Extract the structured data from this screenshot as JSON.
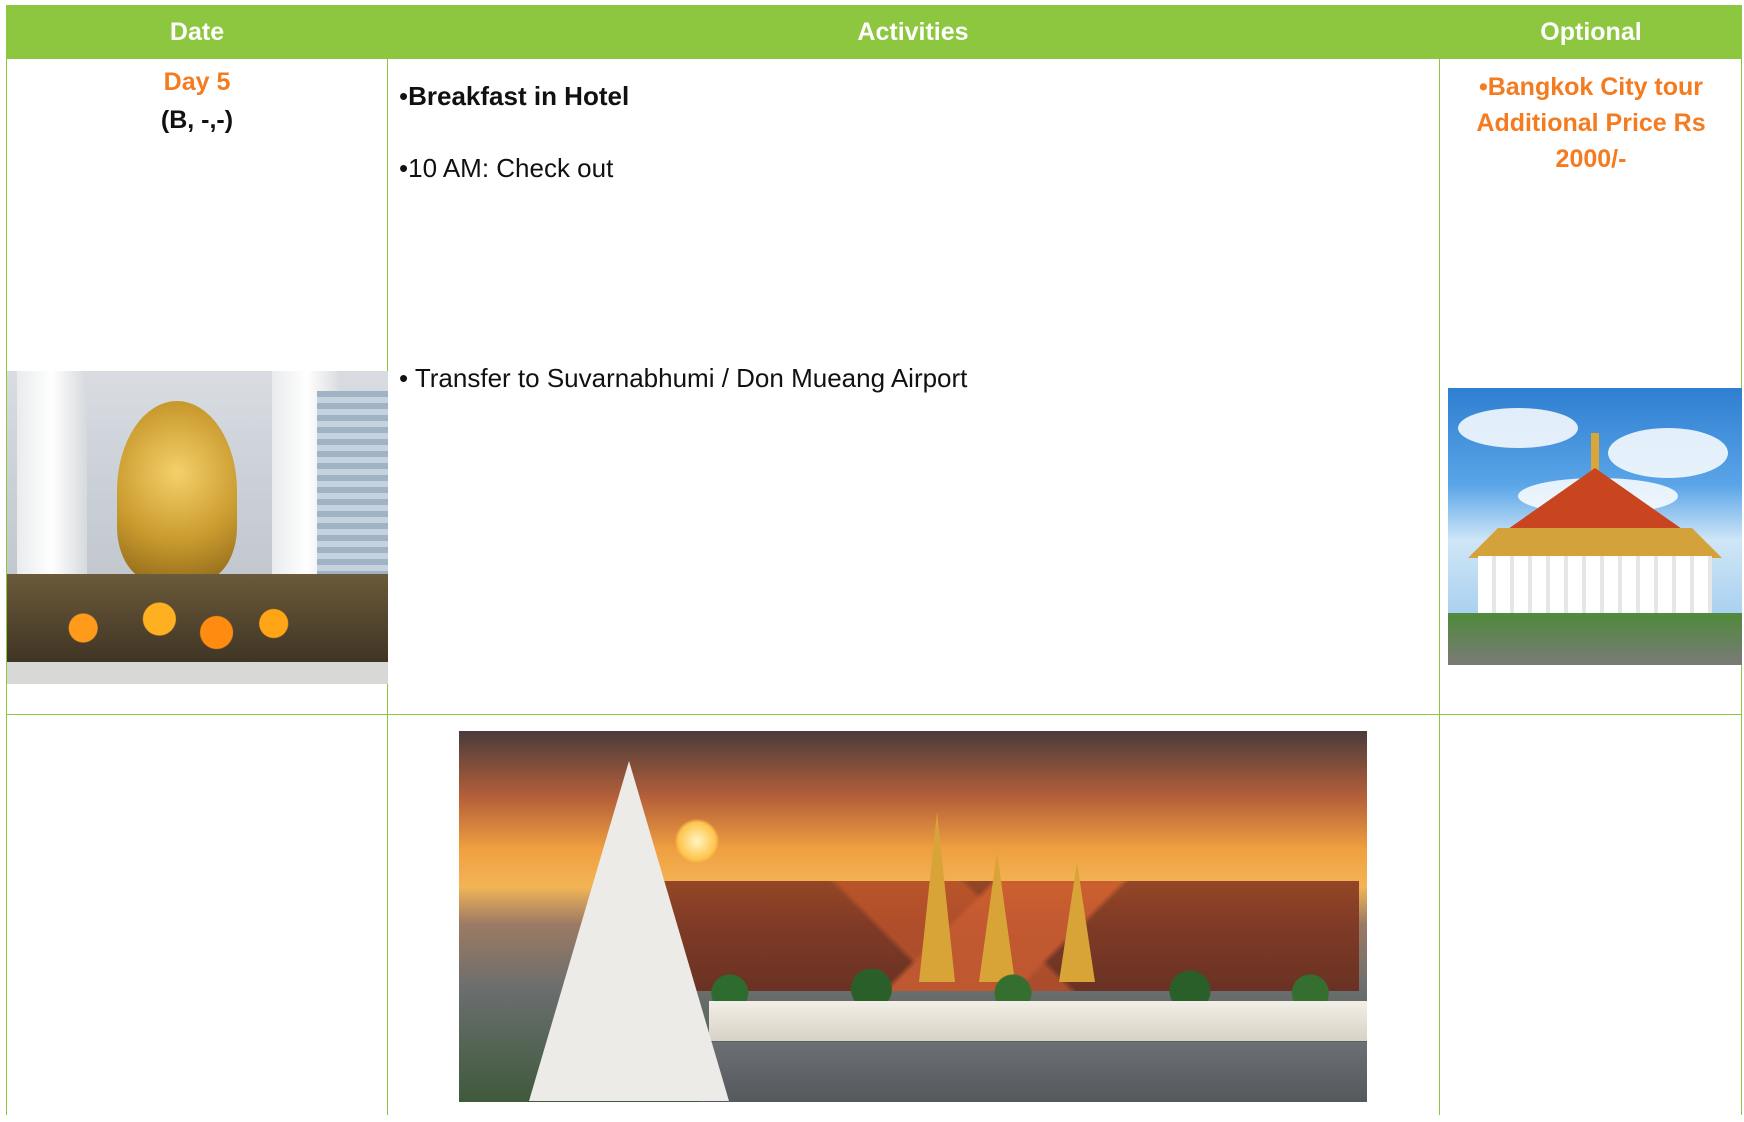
{
  "header": {
    "date": "Date",
    "activities": "Activities",
    "optional": "Optional"
  },
  "day": {
    "title": "Day 5",
    "meals": "(B, -,-)"
  },
  "activities": [
    {
      "bullet": "•",
      "text": "Breakfast in Hotel",
      "bold": true
    },
    {
      "bullet": "•",
      "text": "10 AM: Check out",
      "bold": false
    },
    {
      "bullet": "• ",
      "text": "Transfer to Suvarnabhumi / Don Mueang  Airport",
      "bold": false
    }
  ],
  "optional": {
    "line1": "•Bangkok City tour",
    "line2": "Additional Price Rs",
    "line3": "2000/-"
  },
  "colors": {
    "header_bg": "#8dc63f",
    "accent_orange": "#f47b20",
    "border": "#8dc63f"
  }
}
